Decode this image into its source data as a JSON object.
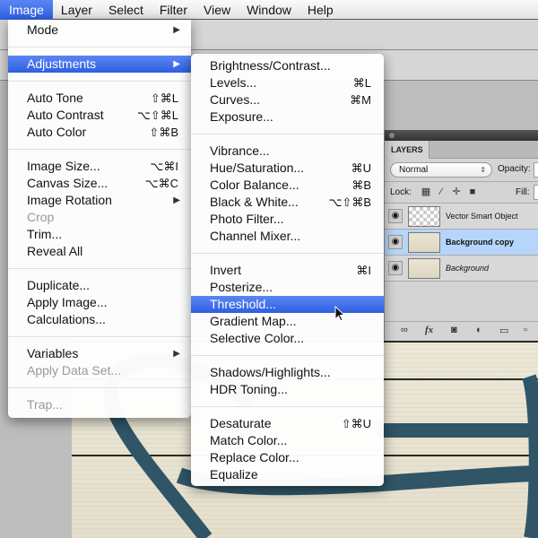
{
  "menubar": {
    "items": [
      "Image",
      "Layer",
      "Select",
      "Filter",
      "View",
      "Window",
      "Help"
    ],
    "active": "Image"
  },
  "image_menu": {
    "items": [
      {
        "label": "Mode",
        "submenu": true
      },
      {
        "separator": true
      },
      {
        "label": "Adjustments",
        "submenu": true,
        "highlighted": true
      },
      {
        "separator": true
      },
      {
        "label": "Auto Tone",
        "shortcut": "⇧⌘L"
      },
      {
        "label": "Auto Contrast",
        "shortcut": "⌥⇧⌘L"
      },
      {
        "label": "Auto Color",
        "shortcut": "⇧⌘B"
      },
      {
        "separator": true
      },
      {
        "label": "Image Size...",
        "shortcut": "⌥⌘I"
      },
      {
        "label": "Canvas Size...",
        "shortcut": "⌥⌘C"
      },
      {
        "label": "Image Rotation",
        "submenu": true
      },
      {
        "label": "Crop",
        "disabled": true
      },
      {
        "label": "Trim..."
      },
      {
        "label": "Reveal All"
      },
      {
        "separator": true
      },
      {
        "label": "Duplicate..."
      },
      {
        "label": "Apply Image..."
      },
      {
        "label": "Calculations..."
      },
      {
        "separator": true
      },
      {
        "label": "Variables",
        "submenu": true
      },
      {
        "label": "Apply Data Set...",
        "disabled": true
      },
      {
        "separator": true
      },
      {
        "label": "Trap...",
        "disabled": true
      }
    ]
  },
  "adjustments_menu": {
    "items": [
      {
        "label": "Brightness/Contrast..."
      },
      {
        "label": "Levels...",
        "shortcut": "⌘L"
      },
      {
        "label": "Curves...",
        "shortcut": "⌘M"
      },
      {
        "label": "Exposure..."
      },
      {
        "separator": true
      },
      {
        "label": "Vibrance..."
      },
      {
        "label": "Hue/Saturation...",
        "shortcut": "⌘U"
      },
      {
        "label": "Color Balance...",
        "shortcut": "⌘B"
      },
      {
        "label": "Black & White...",
        "shortcut": "⌥⇧⌘B"
      },
      {
        "label": "Photo Filter..."
      },
      {
        "label": "Channel Mixer..."
      },
      {
        "separator": true
      },
      {
        "label": "Invert",
        "shortcut": "⌘I"
      },
      {
        "label": "Posterize..."
      },
      {
        "label": "Threshold...",
        "highlighted": true
      },
      {
        "label": "Gradient Map..."
      },
      {
        "label": "Selective Color..."
      },
      {
        "separator": true
      },
      {
        "label": "Shadows/Highlights..."
      },
      {
        "label": "HDR Toning..."
      },
      {
        "separator": true
      },
      {
        "label": "Desaturate",
        "shortcut": "⇧⌘U"
      },
      {
        "label": "Match Color..."
      },
      {
        "label": "Replace Color..."
      },
      {
        "label": "Equalize"
      }
    ]
  },
  "layers_panel": {
    "tab": "LAYERS",
    "blend_mode": "Normal",
    "opacity_label": "Opacity:",
    "lock_label": "Lock:",
    "fill_label": "Fill:",
    "lock_icons": [
      "transparency-lock-icon",
      "brush-lock-icon",
      "move-lock-icon",
      "padlock-icon"
    ],
    "layers": [
      {
        "name": "Vector Smart Object",
        "visible": true,
        "selected": false,
        "italic": false,
        "type": "smart"
      },
      {
        "name": "Background copy",
        "visible": true,
        "selected": true,
        "italic": false,
        "type": "raster"
      },
      {
        "name": "Background",
        "visible": true,
        "selected": false,
        "italic": true,
        "type": "raster"
      }
    ],
    "footer_icons": [
      "link-icon",
      "fx-icon",
      "mask-icon",
      "adjustment-icon",
      "folder-icon",
      "new-layer-icon"
    ]
  },
  "colors": {
    "highlight": "#3a6ae8",
    "selected_layer": "#b5d5fa",
    "artwork_stroke": "#2f5566"
  }
}
